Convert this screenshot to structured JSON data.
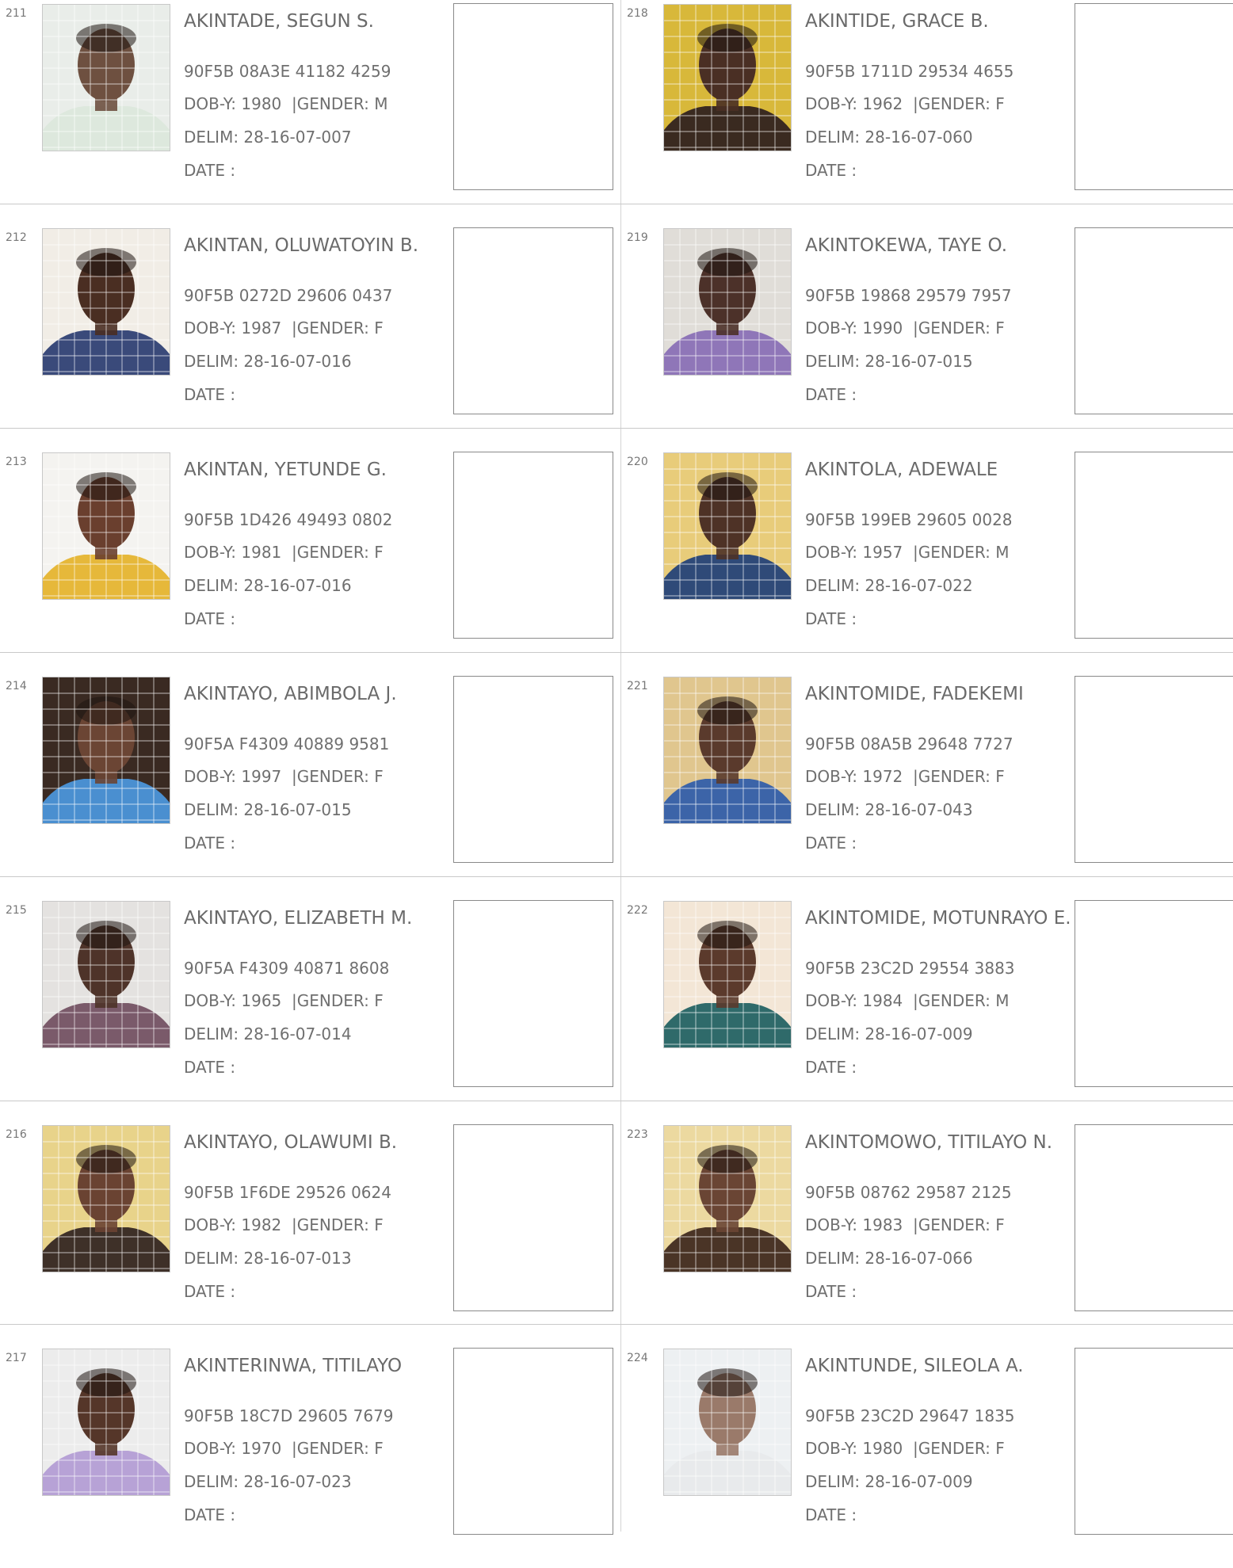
{
  "colors": {
    "text": "#6b6b6b",
    "divider": "#c9c9c9",
    "box_border": "#8a8a8a"
  },
  "entries": [
    {
      "serial": "211",
      "name": "AKINTADE, SEGUN S.",
      "vin": "90F5B 08A3E 41182 4259",
      "dob": "DOB-Y: 1980",
      "gender": "GENDER: M",
      "delim": "DELIM: 28-16-07-007",
      "date": "DATE  :",
      "photo_bg": "#e9ede9",
      "photo_fg": "#6e5040",
      "photo_cloth": "#dde8dd"
    },
    {
      "serial": "212",
      "name": "AKINTAN, OLUWATOYIN B.",
      "vin": "90F5B 0272D 29606 0437",
      "dob": "DOB-Y: 1987",
      "gender": "GENDER: F",
      "delim": "DELIM: 28-16-07-016",
      "date": "DATE  :",
      "photo_bg": "#f1ede6",
      "photo_fg": "#4a2e22",
      "photo_cloth": "#3a4a7a"
    },
    {
      "serial": "213",
      "name": "AKINTAN, YETUNDE G.",
      "vin": "90F5B 1D426 49493 0802",
      "dob": "DOB-Y: 1981",
      "gender": "GENDER: F",
      "delim": "DELIM: 28-16-07-016",
      "date": "DATE  :",
      "photo_bg": "#f4f3f0",
      "photo_fg": "#6a3f2e",
      "photo_cloth": "#e6b83a"
    },
    {
      "serial": "214",
      "name": "AKINTAYO, ABIMBOLA J.",
      "vin": "90F5A F4309 40889 9581",
      "dob": "DOB-Y: 1997",
      "gender": "GENDER: F",
      "delim": "DELIM: 28-16-07-015",
      "date": "DATE  :",
      "photo_bg": "#3a2a22",
      "photo_fg": "#6b4534",
      "photo_cloth": "#4a8fd0"
    },
    {
      "serial": "215",
      "name": "AKINTAYO, ELIZABETH M.",
      "vin": "90F5A F4309 40871 8608",
      "dob": "DOB-Y: 1965",
      "gender": "GENDER: F",
      "delim": "DELIM: 28-16-07-014",
      "date": "DATE  :",
      "photo_bg": "#e4e2e0",
      "photo_fg": "#4e3329",
      "photo_cloth": "#7a5a6a"
    },
    {
      "serial": "216",
      "name": "AKINTAYO, OLAWUMI B.",
      "vin": "90F5B 1F6DE 29526 0624",
      "dob": "DOB-Y: 1982",
      "gender": "GENDER: F",
      "delim": "DELIM: 28-16-07-013",
      "date": "DATE  :",
      "photo_bg": "#e8d38a",
      "photo_fg": "#6a4332",
      "photo_cloth": "#3e3028"
    },
    {
      "serial": "217",
      "name": "AKINTERINWA, TITILAYO",
      "vin": "90F5B 18C7D 29605 7679",
      "dob": "DOB-Y: 1970",
      "gender": "GENDER: F",
      "delim": "DELIM: 28-16-07-023",
      "date": "DATE  :",
      "photo_bg": "#ececec",
      "photo_fg": "#553629",
      "photo_cloth": "#b7a2d6"
    },
    {
      "serial": "218",
      "name": "AKINTIDE, GRACE B.",
      "vin": "90F5B 1711D 29534 4655",
      "dob": "DOB-Y: 1962",
      "gender": "GENDER: F",
      "delim": "DELIM: 28-16-07-060",
      "date": "DATE  :",
      "photo_bg": "#d8b83a",
      "photo_fg": "#4a2f24",
      "photo_cloth": "#3a2a20"
    },
    {
      "serial": "219",
      "name": "AKINTOKEWA, TAYE O.",
      "vin": "90F5B 19868 29579 7957",
      "dob": "DOB-Y: 1990",
      "gender": "GENDER: F",
      "delim": "DELIM: 28-16-07-015",
      "date": "DATE  :",
      "photo_bg": "#e0ddd8",
      "photo_fg": "#4c3129",
      "photo_cloth": "#8f76b8"
    },
    {
      "serial": "220",
      "name": "AKINTOLA, ADEWALE",
      "vin": "90F5B 199EB 29605 0028",
      "dob": "DOB-Y: 1957",
      "gender": "GENDER: M",
      "delim": "DELIM: 28-16-07-022",
      "date": "DATE  :",
      "photo_bg": "#e8cc7a",
      "photo_fg": "#4e3226",
      "photo_cloth": "#2f4a78"
    },
    {
      "serial": "221",
      "name": "AKINTOMIDE, FADEKEMI",
      "vin": "90F5B 08A5B 29648 7727",
      "dob": "DOB-Y: 1972",
      "gender": "GENDER: F",
      "delim": "DELIM: 28-16-07-043",
      "date": "DATE  :",
      "photo_bg": "#e0c68e",
      "photo_fg": "#5a3a2c",
      "photo_cloth": "#3c64a8"
    },
    {
      "serial": "222",
      "name": "AKINTOMIDE, MOTUNRAYO E.",
      "vin": "90F5B 23C2D 29554 3883",
      "dob": "DOB-Y: 1984",
      "gender": "GENDER: M",
      "delim": "DELIM: 28-16-07-009",
      "date": "DATE  :",
      "photo_bg": "#f3e6d6",
      "photo_fg": "#5b3a2c",
      "photo_cloth": "#2f6a6a"
    },
    {
      "serial": "223",
      "name": "AKINTOMOWO, TITILAYO N.",
      "vin": "90F5B 08762 29587 2125",
      "dob": "DOB-Y: 1983",
      "gender": "GENDER: F",
      "delim": "DELIM: 28-16-07-066",
      "date": "DATE  :",
      "photo_bg": "#ecd9a0",
      "photo_fg": "#6a4534",
      "photo_cloth": "#4a3426"
    },
    {
      "serial": "224",
      "name": "AKINTUNDE, SILEOLA A.",
      "vin": "90F5B 23C2D 29647 1835",
      "dob": "DOB-Y: 1980",
      "gender": "GENDER: F",
      "delim": "DELIM: 28-16-07-009",
      "date": "DATE  :",
      "photo_bg": "#edf0f2",
      "photo_fg": "#9a7a6a",
      "photo_cloth": "#e8eaec"
    }
  ]
}
